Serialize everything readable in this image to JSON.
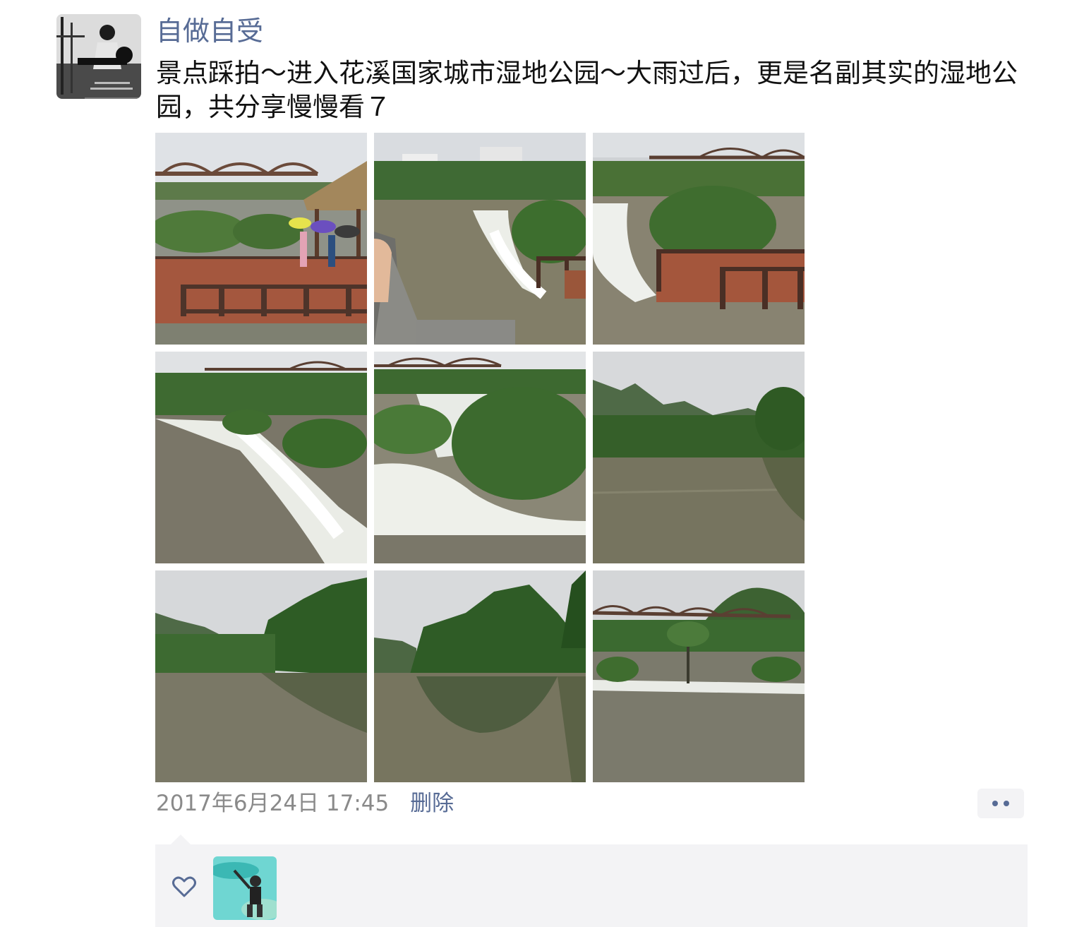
{
  "post": {
    "username": "自做自受",
    "text": "景点踩拍～进入花溪国家城市湿地公园～大雨过后，更是名副其实的湿地公园，共分享慢慢看７",
    "photos": [
      {
        "name": "photo-pavilion-bridge"
      },
      {
        "name": "photo-weir-rapids"
      },
      {
        "name": "photo-boardwalk-rapids"
      },
      {
        "name": "photo-flooded-weir"
      },
      {
        "name": "photo-white-water"
      },
      {
        "name": "photo-river-hills"
      },
      {
        "name": "photo-river-trees"
      },
      {
        "name": "photo-river-reflection"
      },
      {
        "name": "photo-bridge-tree"
      }
    ],
    "timestamp": "2017年6月24日 17:45",
    "delete_label": "删除"
  },
  "colors": {
    "link": "#576b95",
    "meta": "#8a8a8a",
    "likes_bg": "#f3f3f5"
  },
  "icons": {
    "more": "more-dots-icon",
    "like": "heart-icon"
  }
}
